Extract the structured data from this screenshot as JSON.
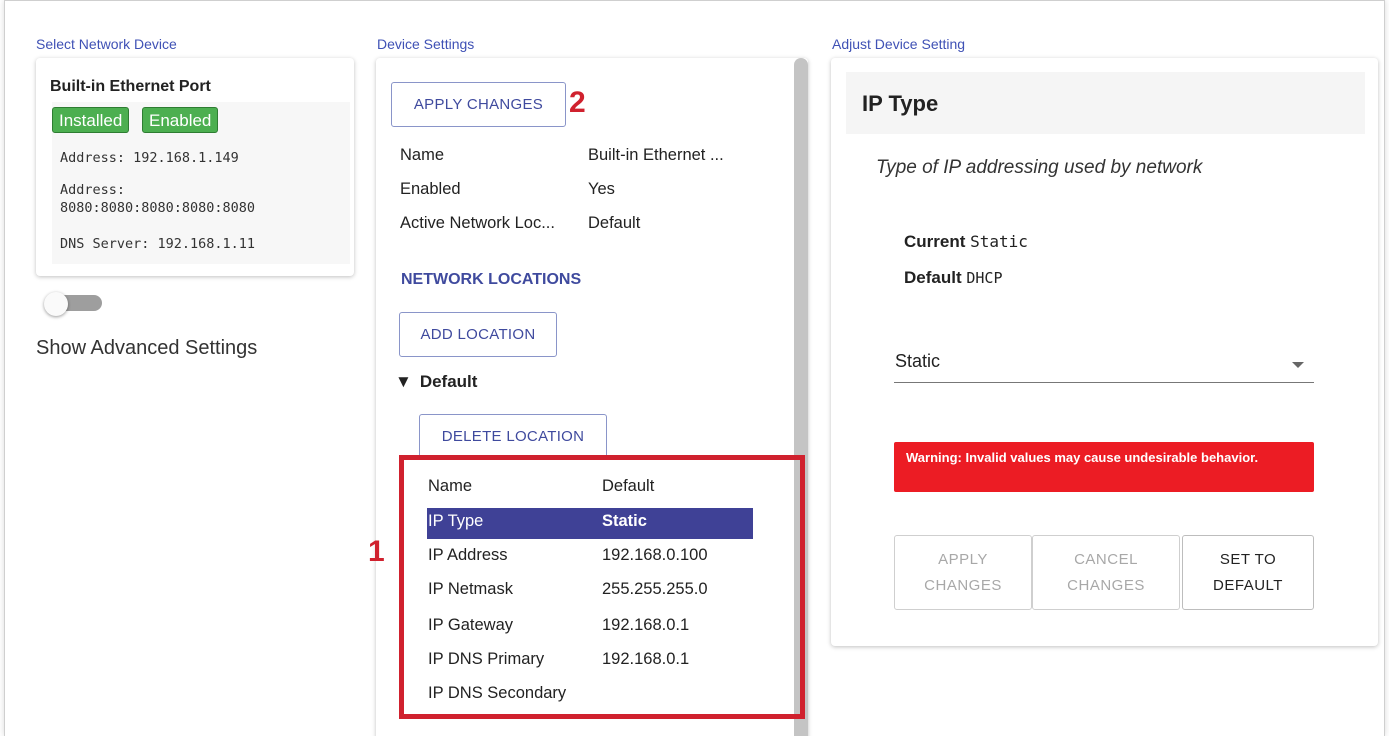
{
  "left": {
    "section_label": "Select Network Device",
    "device_title": "Built-in Ethernet Port",
    "badges": [
      "Installed",
      "Enabled"
    ],
    "addresses": [
      "Address: 192.168.1.149",
      "Address:",
      "8080:8080:8080:8080:8080",
      "DNS Server: 192.168.1.11"
    ],
    "toggle_label": "Show Advanced Settings"
  },
  "middle": {
    "section_label": "Device Settings",
    "apply_button": "APPLY CHANGES",
    "settings": [
      {
        "label": "Name",
        "value": "Built-in Ethernet ..."
      },
      {
        "label": "Enabled",
        "value": "Yes"
      },
      {
        "label": "Active Network Loc...",
        "value": "Default"
      }
    ],
    "network_locations_heading": "NETWORK LOCATIONS",
    "add_location_button": "ADD LOCATION",
    "location_toggle_glyph": "▼",
    "location_name": "Default",
    "delete_location_button": "DELETE LOCATION",
    "location_rows": [
      {
        "label": "Name",
        "value": "Default"
      },
      {
        "label": "IP Type",
        "value": "Static"
      },
      {
        "label": "IP Address",
        "value": "192.168.0.100"
      },
      {
        "label": "IP Netmask",
        "value": "255.255.255.0"
      },
      {
        "label": "IP Gateway",
        "value": "192.168.0.1"
      },
      {
        "label": "IP DNS Primary",
        "value": "192.168.0.1"
      },
      {
        "label": "IP DNS Secondary",
        "value": ""
      }
    ],
    "selected_row": "IP Type"
  },
  "right": {
    "section_label": "Adjust Device Setting",
    "title": "IP Type",
    "description": "Type of IP addressing used by network",
    "current_label": "Current",
    "current_value": "Static",
    "default_label": "Default",
    "default_value": "DHCP",
    "select_value": "Static",
    "warning": "Warning: Invalid values may cause undesirable behavior.",
    "buttons": [
      {
        "line1": "APPLY",
        "line2": "CHANGES",
        "enabled": false
      },
      {
        "line1": "CANCEL",
        "line2": "CHANGES",
        "enabled": false
      },
      {
        "line1": "SET TO",
        "line2": "DEFAULT",
        "enabled": true
      }
    ]
  },
  "annotations": {
    "box_number": "1",
    "apply_number": "2"
  },
  "colors": {
    "accent": "#3f51b5",
    "badge_green": "#4caf50",
    "selected_row": "#3f4196",
    "warning_red": "#ec1c24",
    "annotation_red": "#d0212e"
  }
}
